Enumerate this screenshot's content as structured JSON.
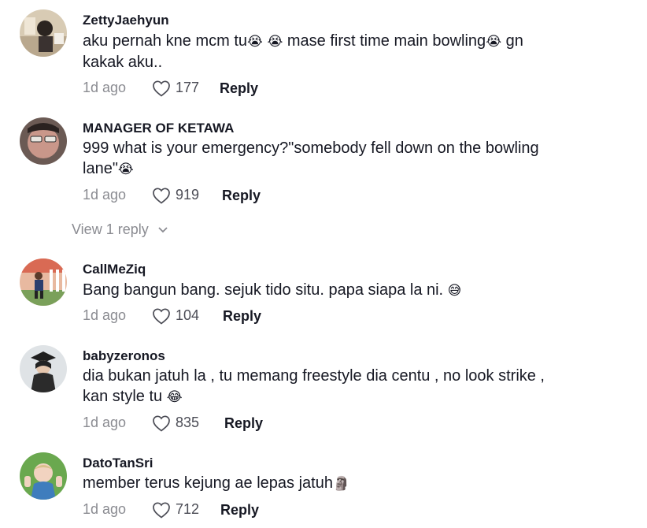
{
  "comments": [
    {
      "username": "ZettyJaehyun",
      "text_parts": [
        "aku pernah kne mcm tu",
        "😭",
        "😭",
        " mase first time main bowling",
        "😭",
        " gn",
        "kakak aku.."
      ],
      "time": "1d ago",
      "likes": "177",
      "reply_label": "Reply"
    },
    {
      "username": "MANAGER OF KETAWA",
      "text_line1": "999 what is your emergency?\"somebody fell down on the bowling",
      "text_line2": "lane\"",
      "emoji": "😭",
      "time": "1d ago",
      "likes": "919",
      "reply_label": "Reply",
      "view_replies": "View 1 reply"
    },
    {
      "username": "CallMeZiq",
      "text": "Bang bangun bang. sejuk tido situ. papa siapa la ni. ",
      "emoji": "😅",
      "time": "1d ago",
      "likes": "104",
      "reply_label": "Reply"
    },
    {
      "username": "babyzeronos",
      "text_line1": "dia bukan jatuh la , tu memang freestyle dia centu , no look strike ,",
      "text_line2": "kan style tu ",
      "emoji": "😂",
      "time": "1d ago",
      "likes": "835",
      "reply_label": "Reply"
    },
    {
      "username": "DatoTanSri",
      "text": "member terus kejung ae lepas jatuh",
      "emoji": "🗿",
      "time": "1d ago",
      "likes": "712",
      "reply_label": "Reply"
    }
  ],
  "icons": {
    "like": "heart-outline-icon",
    "expand": "chevron-down-icon"
  },
  "colors": {
    "text": "#161823",
    "muted": "#8a8b91",
    "background": "#ffffff"
  }
}
